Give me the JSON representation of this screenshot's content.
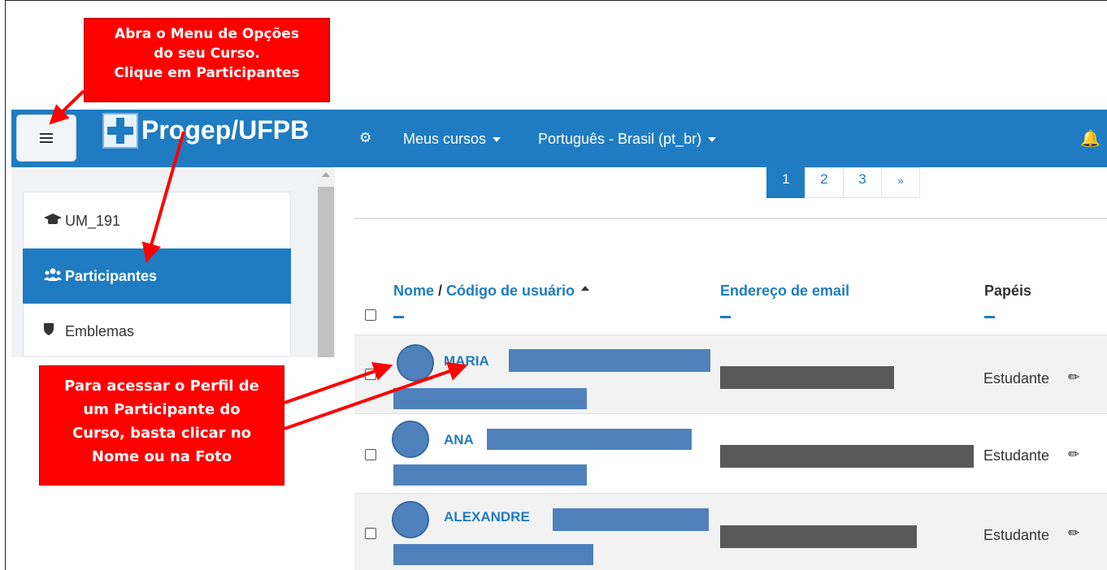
{
  "navbar": {
    "menu_icon": "hamburger-icon",
    "logo_icon": "blue-cross-logo",
    "logo_text": "Progep/UFPB",
    "cogs_icon": "cogs-icon",
    "my_courses": "Meus cursos",
    "language": "Português - Brasil (pt_br)",
    "bell_icon": "bell-icon",
    "color": "#1f7cc2"
  },
  "sidebar": {
    "items": [
      {
        "label": "UM_191",
        "icon": "graduation-cap-icon",
        "active": false
      },
      {
        "label": "Participantes",
        "icon": "users-icon",
        "active": true
      },
      {
        "label": "Emblemas",
        "icon": "shield-icon",
        "active": false
      }
    ]
  },
  "pagination": {
    "pages": [
      "1",
      "2",
      "3",
      "»"
    ],
    "current": "1"
  },
  "table": {
    "headers": {
      "name": "Nome",
      "separator": " / ",
      "username": "Código de usuário",
      "email": "Endereço de email",
      "roles": "Papéis"
    },
    "rows": [
      {
        "name": "MARIA",
        "role": "Estudante"
      },
      {
        "name": "ANA",
        "role": "Estudante"
      },
      {
        "name": "ALEXANDRE",
        "role": "Estudante"
      }
    ]
  },
  "callouts": {
    "menu": {
      "lines": [
        "Abra o Menu de Opções",
        "do seu Curso.",
        "Clique em Participantes"
      ]
    },
    "profile": {
      "lines": [
        "Para acessar o Perfil de",
        "um Participante do",
        "Curso, basta clicar no",
        "Nome ou na Foto"
      ]
    },
    "color": "#ff0000"
  }
}
